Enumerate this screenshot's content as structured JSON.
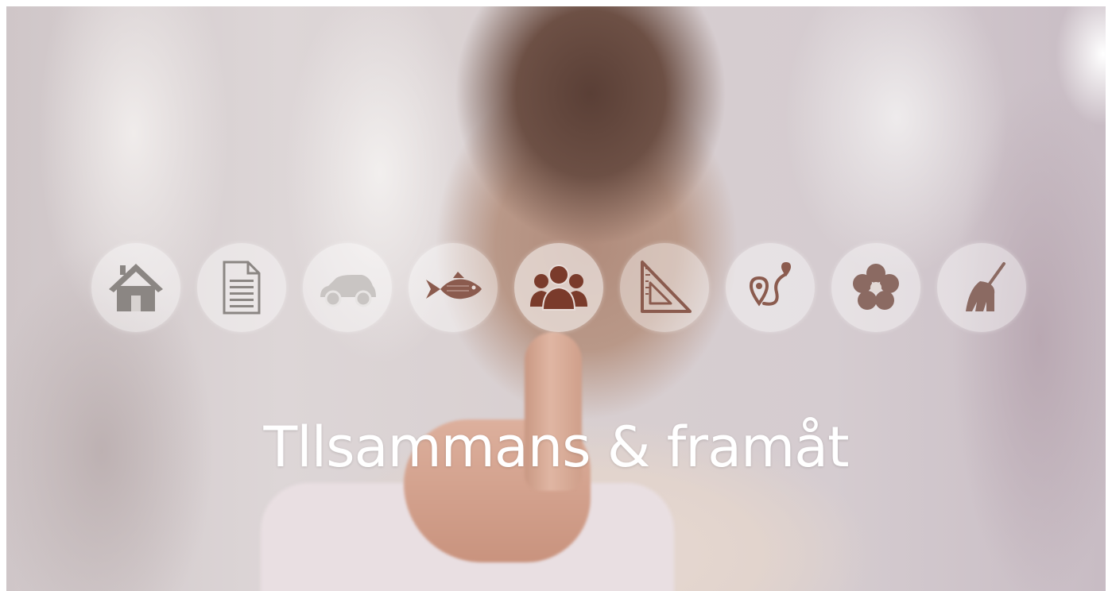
{
  "headline": "Tllsammans & framåt",
  "colors": {
    "icon": "#8b8683",
    "icon_active": "#7a3b2b",
    "circle": "rgba(255,255,255,0.42)",
    "text": "#ffffff"
  },
  "icons": [
    {
      "name": "house-icon"
    },
    {
      "name": "document-icon"
    },
    {
      "name": "car-icon"
    },
    {
      "name": "fish-icon"
    },
    {
      "name": "people-icon",
      "active": true
    },
    {
      "name": "set-square-icon"
    },
    {
      "name": "route-pin-icon"
    },
    {
      "name": "flower-icon"
    },
    {
      "name": "broom-icon"
    }
  ]
}
